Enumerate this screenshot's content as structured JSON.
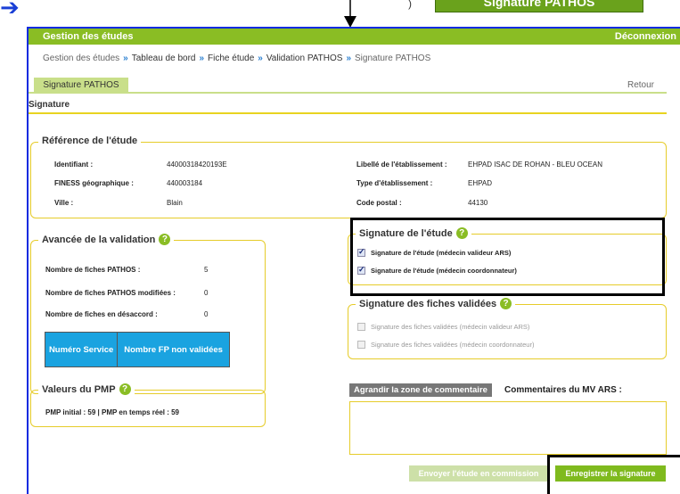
{
  "overlay": {
    "banner_label": "Signature PATHOS"
  },
  "header": {
    "title": "Gestion des études",
    "logout": "Déconnexion"
  },
  "breadcrumb": {
    "items": [
      "Gestion des études",
      "Tableau de bord",
      "Fiche étude",
      "Validation PATHOS",
      "Signature PATHOS"
    ]
  },
  "tabs": {
    "active": "Signature PATHOS",
    "back": "Retour"
  },
  "section_title": "Signature",
  "reference": {
    "legend": "Référence de l'étude",
    "identifiant_label": "Identifiant :",
    "identifiant_value": "44000318420193E",
    "finess_label": "FINESS géographique :",
    "finess_value": "440003184",
    "ville_label": "Ville :",
    "ville_value": "Blain",
    "libelle_label": "Libellé de l'établissement :",
    "libelle_value": "EHPAD ISAC DE ROHAN - BLEU OCEAN",
    "type_label": "Type d'établissement :",
    "type_value": "EHPAD",
    "cp_label": "Code postal :",
    "cp_value": "44130"
  },
  "avancee": {
    "legend": "Avancée de la validation",
    "rows": [
      {
        "label": "Nombre de fiches PATHOS :",
        "value": "5"
      },
      {
        "label": "Nombre de fiches PATHOS modifiées :",
        "value": "0"
      },
      {
        "label": "Nombre de fiches en désaccord :",
        "value": "0"
      }
    ],
    "table_headers": [
      "Numéro Service",
      "Nombre FP non validées"
    ]
  },
  "pmp": {
    "legend": "Valeurs du PMP",
    "text": "PMP initial : 59  |  PMP en temps réel : 59"
  },
  "signature_etude": {
    "legend": "Signature de l'étude",
    "items": [
      {
        "label": "Signature de l'étude (médecin valideur ARS)",
        "checked": true
      },
      {
        "label": "Signature de l'étude (médecin coordonnateur)",
        "checked": true
      }
    ]
  },
  "signature_fiches": {
    "legend": "Signature des fiches validées",
    "items": [
      {
        "label": "Signature des fiches validées (médecin valideur ARS)",
        "checked": false
      },
      {
        "label": "Signature des fiches validées (médecin coordonnateur)",
        "checked": false
      }
    ]
  },
  "comments": {
    "expand_button": "Agrandir la zone de commentaire",
    "label": "Commentaires du MV ARS :",
    "value": ""
  },
  "actions": {
    "send": "Envoyer l'étude en commission",
    "save": "Enregistrer la signature"
  },
  "colors": {
    "header_green": "#8abd24",
    "border_yellow": "#e6cc2a",
    "table_blue": "#1aa3e0",
    "frame_blue": "#0b2be0"
  }
}
